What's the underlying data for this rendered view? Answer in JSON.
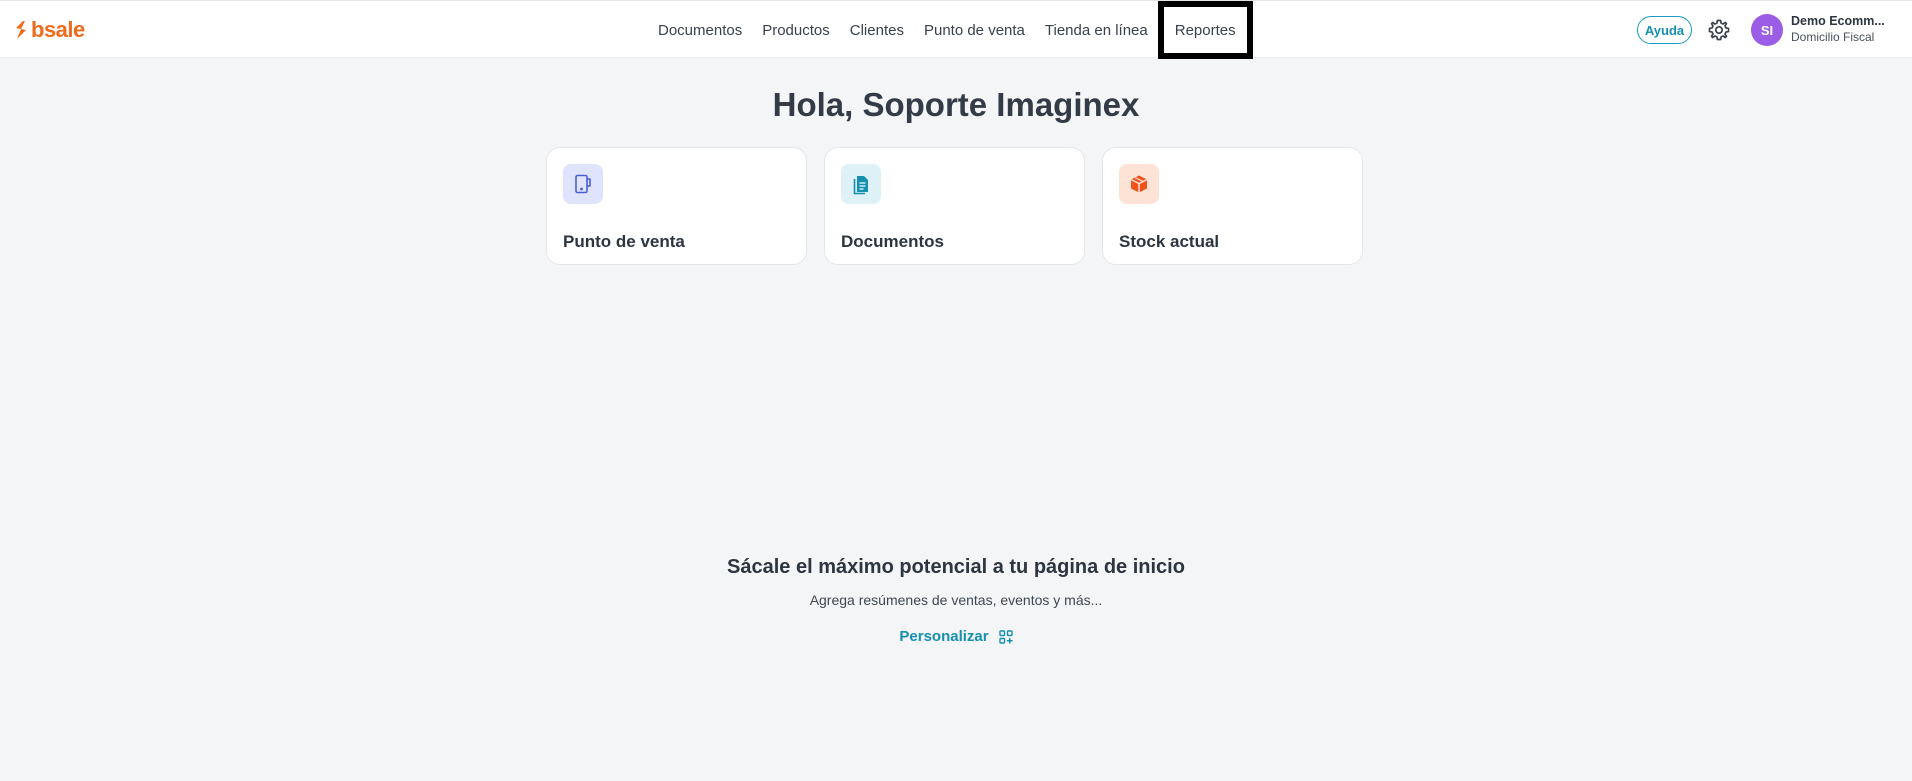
{
  "brand": {
    "name": "bsale",
    "color": "#f26b1d"
  },
  "nav": {
    "items": [
      {
        "label": "Documentos"
      },
      {
        "label": "Productos"
      },
      {
        "label": "Clientes"
      },
      {
        "label": "Punto de venta"
      },
      {
        "label": "Tienda en línea"
      },
      {
        "label": "Reportes"
      }
    ]
  },
  "header": {
    "help_label": "Ayuda",
    "settings_icon": "gear-icon",
    "avatar_initials": "SI",
    "account_name": "Demo Ecomm...",
    "account_subtitle": "Domicilio Fiscal"
  },
  "main": {
    "greeting": "Hola, Soporte Imaginex",
    "cards": [
      {
        "label": "Punto de venta",
        "icon": "pos-device-icon",
        "icon_bg": "#dfe3fb",
        "icon_color": "#4b5fd6"
      },
      {
        "label": "Documentos",
        "icon": "document-icon",
        "icon_bg": "#ddf1f6",
        "icon_color": "#1590ae"
      },
      {
        "label": "Stock actual",
        "icon": "box-icon",
        "icon_bg": "#fde2d6",
        "icon_color": "#f0521c"
      }
    ],
    "promo_title": "Sácale el máximo potencial a tu página de inicio",
    "promo_subtitle": "Agrega resúmenes de ventas, eventos y más...",
    "personalize_label": "Personalizar"
  },
  "colors": {
    "accent": "#1590ae",
    "background": "#f4f5f7",
    "avatar": "#9b5de5"
  }
}
